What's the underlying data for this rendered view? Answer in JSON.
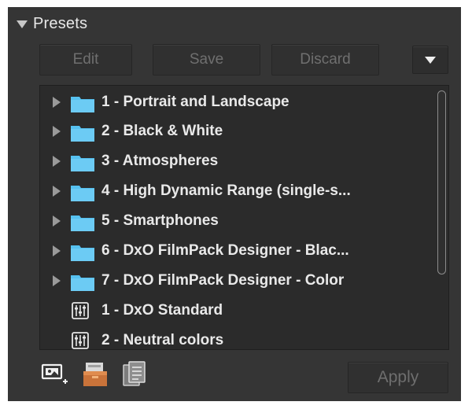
{
  "panel": {
    "title": "Presets"
  },
  "toolbar": {
    "edit_label": "Edit",
    "save_label": "Save",
    "discard_label": "Discard",
    "menu_icon": "dropdown-triangle-icon"
  },
  "presets": {
    "items": [
      {
        "type": "folder",
        "label": "1 - Portrait and Landscape"
      },
      {
        "type": "folder",
        "label": "2 - Black & White"
      },
      {
        "type": "folder",
        "label": "3 - Atmospheres"
      },
      {
        "type": "folder",
        "label": "4 - High Dynamic Range (single-s..."
      },
      {
        "type": "folder",
        "label": "5 - Smartphones"
      },
      {
        "type": "folder",
        "label": "6 - DxO FilmPack Designer - Blac..."
      },
      {
        "type": "folder",
        "label": "7 - DxO FilmPack Designer - Color"
      },
      {
        "type": "preset",
        "label": "1 - DxO Standard"
      },
      {
        "type": "preset",
        "label": "2 - Neutral colors"
      }
    ]
  },
  "footer": {
    "apply_label": "Apply"
  },
  "colors": {
    "panel_bg": "#353535",
    "list_bg": "#2b2b2b",
    "folder_blue": "#56c1f0",
    "text": "#e9e9e9",
    "disabled_text": "#6f6f6f"
  }
}
